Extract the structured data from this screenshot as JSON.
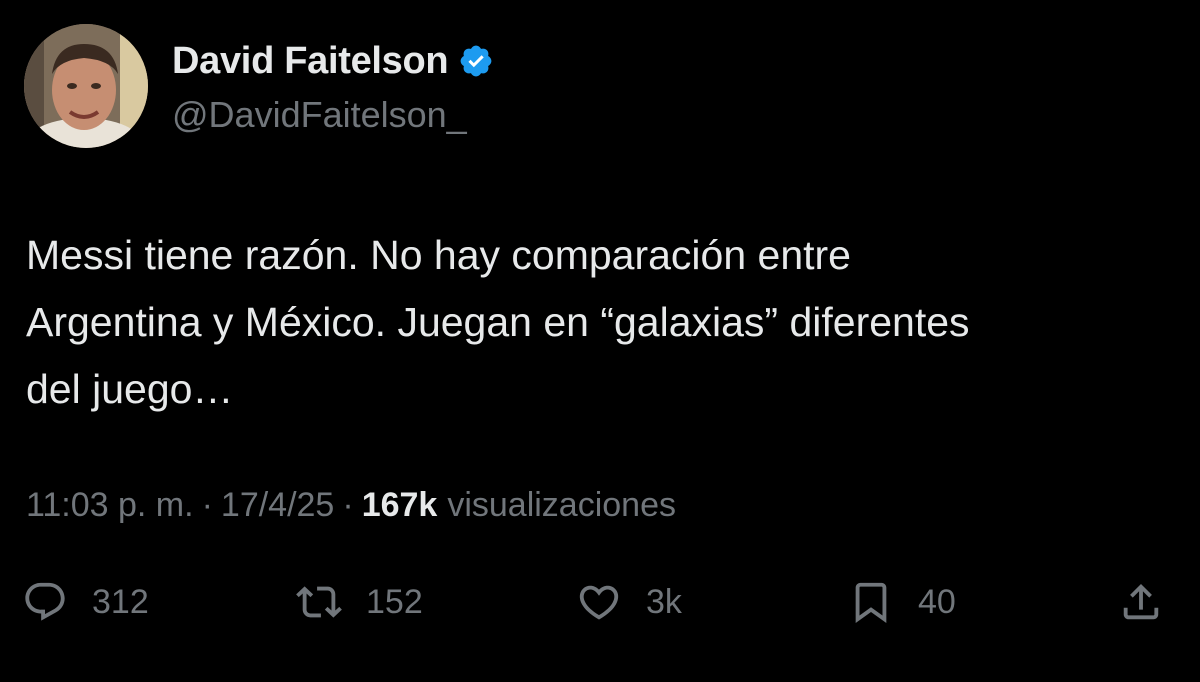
{
  "author": {
    "display_name": "David Faitelson",
    "handle": "@DavidFaitelson_",
    "verified": true,
    "verified_color": "#1d9bf0"
  },
  "tweet": {
    "text": "Messi tiene razón. No hay comparación entre\nArgentina y México. Juegan en “galaxias” diferentes\ndel juego…"
  },
  "meta": {
    "time": "11:03 p. m.",
    "date": "17/4/25",
    "separator": "·",
    "views_count": "167k",
    "views_label": "visualizaciones"
  },
  "actions": {
    "reply": {
      "icon": "reply-icon",
      "count": "312"
    },
    "retweet": {
      "icon": "retweet-icon",
      "count": "152"
    },
    "like": {
      "icon": "heart-icon",
      "count": "3k"
    },
    "bookmark": {
      "icon": "bookmark-icon",
      "count": "40"
    },
    "share": {
      "icon": "share-icon"
    }
  },
  "colors": {
    "background": "#000000",
    "text_primary": "#e7e9ea",
    "text_secondary": "#71767b"
  }
}
